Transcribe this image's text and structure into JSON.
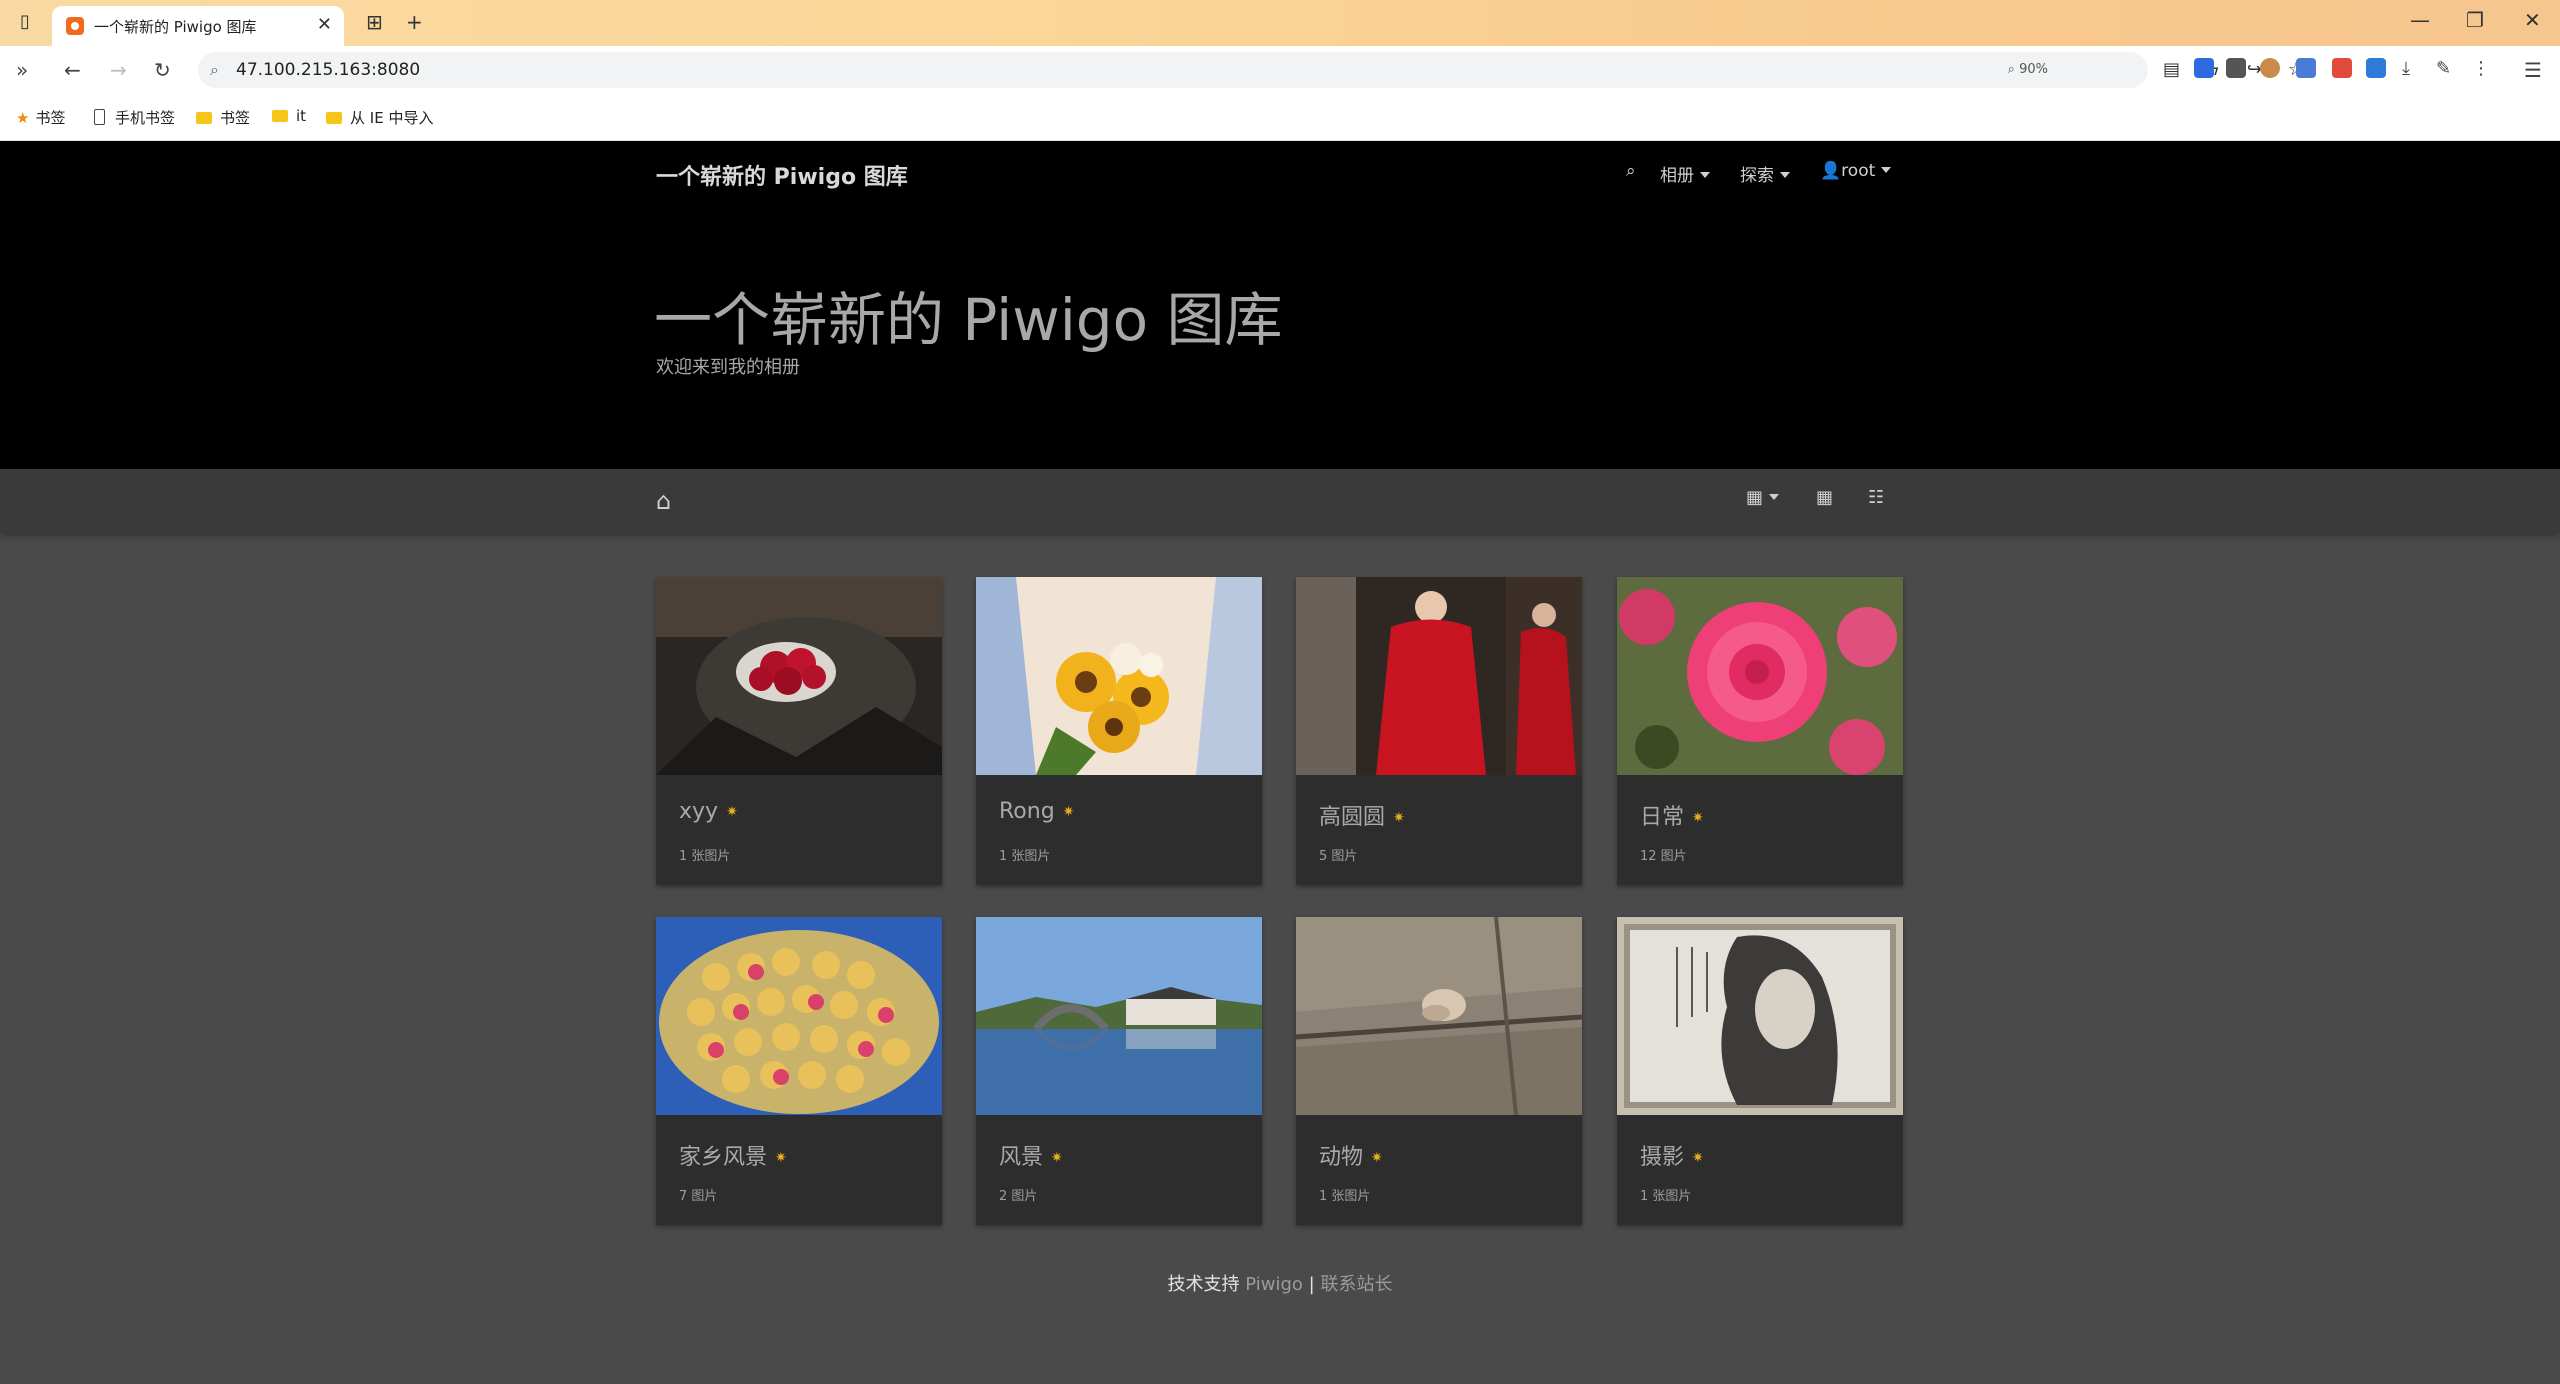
{
  "browser": {
    "tab_title": "一个崭新的 Piwigo 图库",
    "url": "47.100.215.163:8080",
    "zoom": "90%",
    "bookmarks": [
      "书签",
      "手机书签",
      "书签",
      "it",
      "从 IE 中导入"
    ]
  },
  "site": {
    "brand": "一个崭新的 Piwigo 图库",
    "nav": {
      "albums": "相册",
      "explore": "探索",
      "user": "root"
    },
    "hero_title": "一个崭新的 Piwigo 图库",
    "hero_subtitle": "欢迎来到我的相册"
  },
  "albums": [
    {
      "name": "xyy",
      "count": "1 张图片"
    },
    {
      "name": "Rong",
      "count": "1 张图片"
    },
    {
      "name": "高圆圆",
      "count": "5 图片"
    },
    {
      "name": "日常",
      "count": "12 图片"
    },
    {
      "name": "家乡风景",
      "count": "7 图片"
    },
    {
      "name": "风景",
      "count": "2 图片"
    },
    {
      "name": "动物",
      "count": "1 张图片"
    },
    {
      "name": "摄影",
      "count": "1 张图片"
    }
  ],
  "footer": {
    "prefix": "技术支持",
    "piwigo": "Piwigo",
    "sep": "|",
    "contact": "联系站长"
  }
}
